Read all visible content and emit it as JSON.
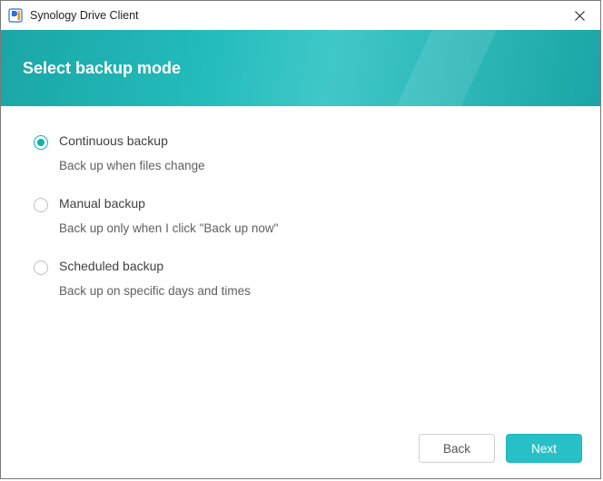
{
  "window": {
    "title": "Synology Drive Client"
  },
  "header": {
    "headline": "Select backup mode"
  },
  "options": [
    {
      "id": "continuous",
      "label": "Continuous backup",
      "desc": "Back up when files change",
      "selected": true
    },
    {
      "id": "manual",
      "label": "Manual backup",
      "desc": "Back up only when I click \"Back up now\"",
      "selected": false
    },
    {
      "id": "scheduled",
      "label": "Scheduled backup",
      "desc": "Back up on specific days and times",
      "selected": false
    }
  ],
  "footer": {
    "back": "Back",
    "next": "Next"
  },
  "colors": {
    "accent": "#0fb1b1",
    "primary_btn": "#28c0c7"
  }
}
